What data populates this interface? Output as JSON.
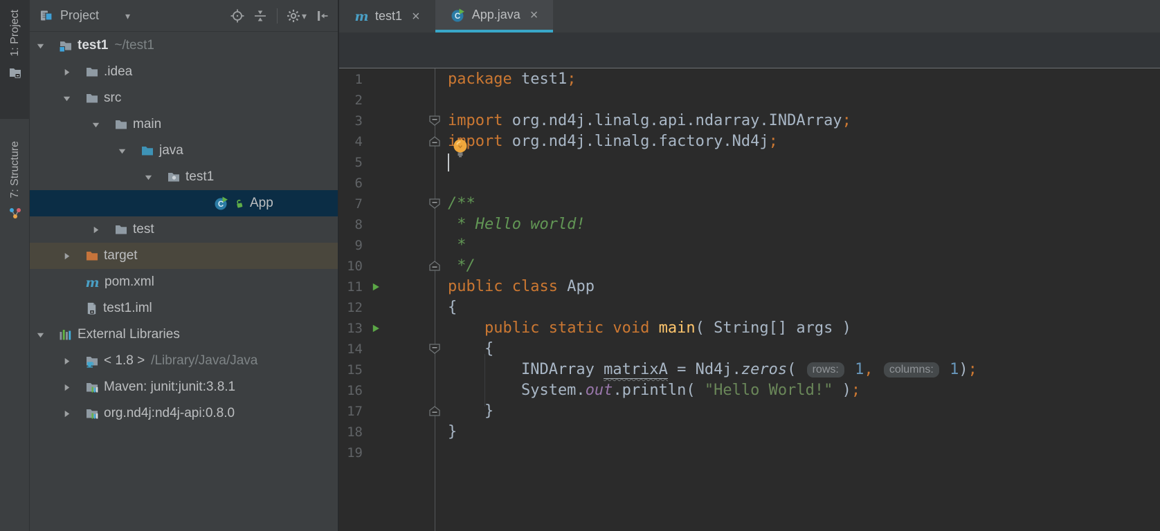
{
  "tool_strip": {
    "project_label": "1: Project",
    "structure_label": "7: Structure"
  },
  "project_panel": {
    "title": "Project",
    "tree": [
      {
        "depth": 0,
        "chevron": "down",
        "icons": [
          "folder-project"
        ],
        "label": "test1",
        "sub": "~/test1",
        "bold": true
      },
      {
        "depth": 1,
        "chevron": "right",
        "icons": [
          "folder"
        ],
        "label": ".idea"
      },
      {
        "depth": 1,
        "chevron": "down",
        "icons": [
          "folder"
        ],
        "label": "src"
      },
      {
        "depth": 2,
        "chevron": "down",
        "icons": [
          "folder"
        ],
        "label": "main"
      },
      {
        "depth": 3,
        "chevron": "down",
        "icons": [
          "folder-source"
        ],
        "label": "java"
      },
      {
        "depth": 4,
        "chevron": "down",
        "icons": [
          "package"
        ],
        "label": "test1"
      },
      {
        "depth": 5,
        "chevron": null,
        "icons": [
          "class",
          "lock"
        ],
        "label": "App",
        "selected": true
      },
      {
        "depth": 2,
        "chevron": "right",
        "icons": [
          "folder"
        ],
        "label": "test"
      },
      {
        "depth": 1,
        "chevron": "right",
        "icons": [
          "folder-excluded"
        ],
        "label": "target",
        "highlight": true
      },
      {
        "depth": 1,
        "chevron": null,
        "icons": [
          "maven"
        ],
        "label": "pom.xml"
      },
      {
        "depth": 1,
        "chevron": null,
        "icons": [
          "module-file"
        ],
        "label": "test1.iml"
      },
      {
        "depth": 0,
        "chevron": "down",
        "icons": [
          "libraries"
        ],
        "label": "External Libraries"
      },
      {
        "depth": 1,
        "chevron": "right",
        "icons": [
          "jdk"
        ],
        "label": "< 1.8 >",
        "sub": "/Library/Java/Java"
      },
      {
        "depth": 1,
        "chevron": "right",
        "icons": [
          "library"
        ],
        "label": "Maven: junit:junit:3.8.1"
      },
      {
        "depth": 1,
        "chevron": "right",
        "icons": [
          "library"
        ],
        "label": "org.nd4j:nd4j-api:0.8.0"
      }
    ]
  },
  "editor": {
    "tabs": [
      {
        "label": "test1",
        "icon": "maven",
        "close_label": "×",
        "selected": false
      },
      {
        "label": "App.java",
        "icon": "class",
        "close_label": "×",
        "selected": true
      }
    ],
    "code": {
      "lines": [
        {
          "n": 1,
          "spans": [
            [
              "k",
              "package"
            ],
            [
              "p",
              " test1"
            ],
            [
              "k",
              ";"
            ]
          ]
        },
        {
          "n": 2,
          "spans": []
        },
        {
          "n": 3,
          "mark": "fold-start",
          "spans": [
            [
              "k",
              "import"
            ],
            [
              "p",
              " org.nd4j.linalg.api.ndarray.INDArray"
            ],
            [
              "k",
              ";"
            ]
          ]
        },
        {
          "n": 4,
          "mark": "fold-end",
          "bulb": true,
          "spans": [
            [
              "k",
              "import"
            ],
            [
              "p",
              " org.nd4j.linalg.factory.Nd4j"
            ],
            [
              "k",
              ";"
            ]
          ]
        },
        {
          "n": 5,
          "caret": true,
          "spans": []
        },
        {
          "n": 6,
          "spans": []
        },
        {
          "n": 7,
          "mark": "fold-start",
          "spans": [
            [
              "d",
              "/**"
            ]
          ]
        },
        {
          "n": 8,
          "spans": [
            [
              "d",
              " * Hello world!"
            ]
          ]
        },
        {
          "n": 9,
          "spans": [
            [
              "d",
              " *"
            ]
          ]
        },
        {
          "n": 10,
          "mark": "fold-end",
          "spans": [
            [
              "d",
              " */"
            ]
          ]
        },
        {
          "n": 11,
          "mark": "run",
          "spans": [
            [
              "k",
              "public class"
            ],
            [
              "p",
              " App"
            ]
          ]
        },
        {
          "n": 12,
          "spans": [
            [
              "p",
              "{"
            ]
          ]
        },
        {
          "n": 13,
          "mark": "run",
          "spans": [
            [
              "p",
              "    "
            ],
            [
              "k",
              "public static void"
            ],
            [
              "m",
              " main"
            ],
            [
              "p",
              "( String[] args )"
            ]
          ]
        },
        {
          "n": 14,
          "mark": "fold-start",
          "spans": [
            [
              "p",
              "    {"
            ]
          ]
        },
        {
          "n": 15,
          "spans": [
            [
              "p",
              "        INDArray "
            ],
            [
              "w",
              "matrixA"
            ],
            [
              "p",
              " = Nd4j."
            ],
            [
              "si",
              "zeros"
            ],
            [
              "p",
              "( "
            ],
            [
              "h",
              "rows:"
            ],
            [
              "p",
              " "
            ],
            [
              "num",
              "1"
            ],
            [
              "k",
              ","
            ],
            [
              "p",
              " "
            ],
            [
              "h",
              "columns:"
            ],
            [
              "p",
              " "
            ],
            [
              "num",
              "1"
            ],
            [
              "p",
              ")"
            ],
            [
              "k",
              ";"
            ]
          ]
        },
        {
          "n": 16,
          "spans": [
            [
              "p",
              "        System."
            ],
            [
              "f",
              "out"
            ],
            [
              "p",
              ".println( "
            ],
            [
              "s",
              "\"Hello World!\""
            ],
            [
              "p",
              " )"
            ],
            [
              "k",
              ";"
            ]
          ]
        },
        {
          "n": 17,
          "mark": "fold-end",
          "spans": [
            [
              "p",
              "    }"
            ]
          ]
        },
        {
          "n": 18,
          "spans": [
            [
              "p",
              "}"
            ]
          ]
        },
        {
          "n": 19,
          "spans": []
        }
      ]
    }
  },
  "colors": {
    "editor_bg": "#2B2B2B",
    "panel_bg": "#3C3F41",
    "selection_bg": "#0B2D45",
    "excluded_row_bg": "#4A473D",
    "tab_underline": "#39A7C9",
    "keyword": "#CC7832",
    "plain_text": "#A9B7C6",
    "string": "#6A8759",
    "number": "#6897BB",
    "javadoc": "#629755",
    "static_field": "#9876AA",
    "method_decl": "#FFC66D",
    "line_number": "#606366",
    "inlay_hint_bg": "#45494B",
    "inlay_hint_text": "#909498",
    "run_arrow": "#5BA746",
    "bulb": "#F0A73C"
  }
}
